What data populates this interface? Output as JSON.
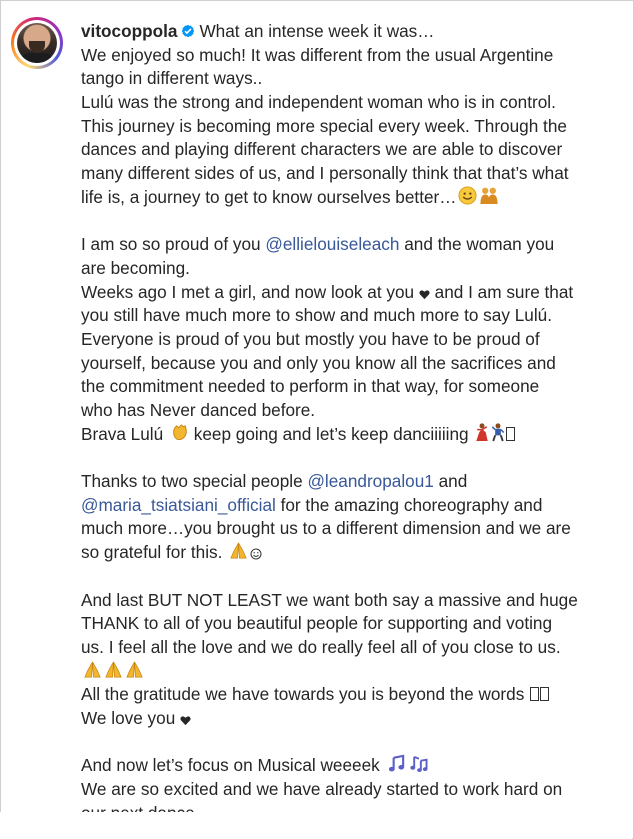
{
  "post": {
    "username": "vitocoppola",
    "verified": true,
    "lines": [
      "What an intense week it was…",
      "We enjoyed so much! It was different from the usual Argentine",
      "tango in different ways..",
      "Lulú was the strong and independent woman who is in control.",
      "This journey is becoming more special every week. Through the",
      "dances and playing different characters we are able to discover",
      "many different sides of us, and I personally think that that’s what",
      "life is, a journey to get to know ourselves better…",
      "I am so so proud of you ",
      "@ellielouiseleach",
      " and the woman you",
      "are becoming.",
      "Weeks ago I met a girl, and now look at you ",
      " and I am sure that",
      "you still have much more to show and much more to say Lulú.",
      "Everyone is proud of you but mostly you have to be proud of",
      "yourself, because you and only you know all the sacrifices and",
      "the commitment needed to perform in that way, for someone",
      "who has Never danced before.",
      "Brava Lulú ",
      " keep going and let’s keep danciiiiing ",
      "Thanks to two special people ",
      "@leandropalou1",
      " and",
      "@maria_tsiatsiani_official",
      " for the amazing choreography and",
      "much more…you brought us to a different dimension and we are",
      "so grateful for this. ",
      "And last BUT NOT LEAST we want both say a massive and huge",
      "THANK to all of you beautiful people for supporting and voting",
      "us. I feel all the love and we do really feel all of you close to us.",
      "All the gratitude we have towards you is beyond the words ",
      "We love you ",
      "And now let’s focus on Musical weeeek ",
      "We are so excited and we have already started to work hard on",
      "our next dance"
    ]
  },
  "colors": {
    "text": "#262626",
    "mention": "#385898",
    "verified": "#0095f6"
  }
}
